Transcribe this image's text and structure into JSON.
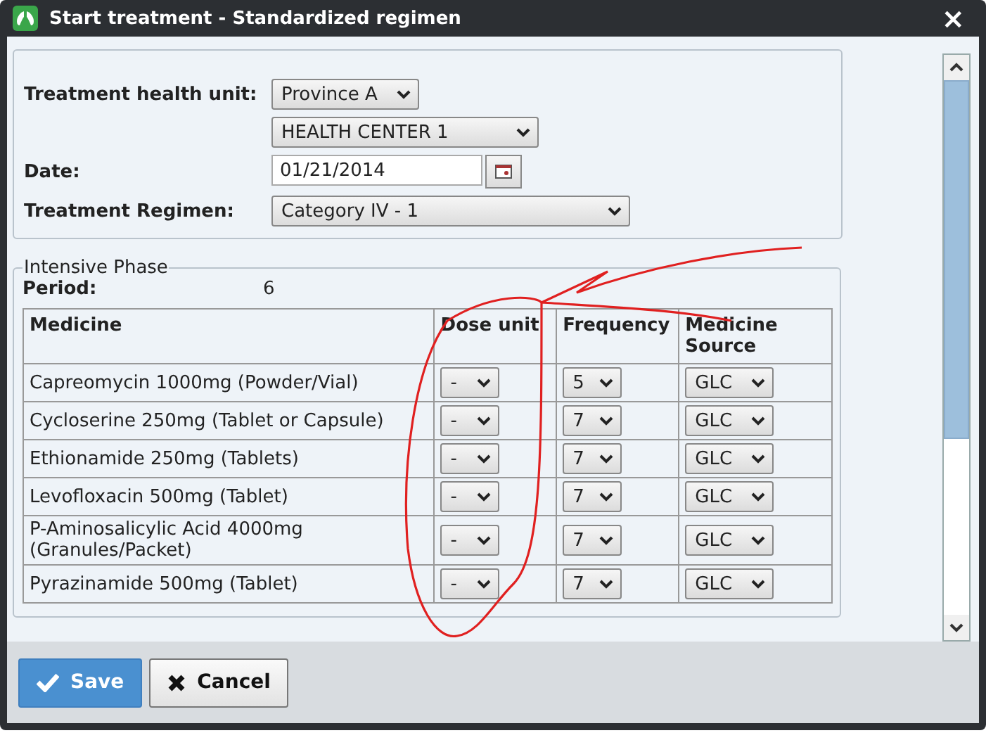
{
  "window": {
    "title": "Start treatment - Standardized regimen",
    "close": "×"
  },
  "form": {
    "unit_label": "Treatment health unit:",
    "province": "Province A",
    "health_center": "HEALTH CENTER 1",
    "date_label": "Date:",
    "date": "01/21/2014",
    "regimen_label": "Treatment Regimen:",
    "regimen": "Category IV - 1"
  },
  "phase": {
    "legend": "Intensive Phase",
    "period_label": "Period:",
    "period": "6",
    "columns": [
      "Medicine",
      "Dose unit",
      "Frequency",
      "Medicine Source"
    ],
    "rows": [
      {
        "medicine": "Capreomycin 1000mg (Powder/Vial)",
        "dose_unit": "-",
        "frequency": "5",
        "source": "GLC"
      },
      {
        "medicine": "Cycloserine 250mg (Tablet or Capsule)",
        "dose_unit": "-",
        "frequency": "7",
        "source": "GLC"
      },
      {
        "medicine": "Ethionamide 250mg (Tablets)",
        "dose_unit": "-",
        "frequency": "7",
        "source": "GLC"
      },
      {
        "medicine": "Levofloxacin 500mg (Tablet)",
        "dose_unit": "-",
        "frequency": "7",
        "source": "GLC"
      },
      {
        "medicine": "P-Aminosalicylic Acid 4000mg (Granules/Packet)",
        "dose_unit": "-",
        "frequency": "7",
        "source": "GLC"
      },
      {
        "medicine": "Pyrazinamide 500mg (Tablet)",
        "dose_unit": "-",
        "frequency": "7",
        "source": "GLC"
      }
    ]
  },
  "buttons": [
    {
      "label": "Save",
      "kind": "primary"
    },
    {
      "label": "Cancel",
      "kind": "secondary"
    }
  ]
}
